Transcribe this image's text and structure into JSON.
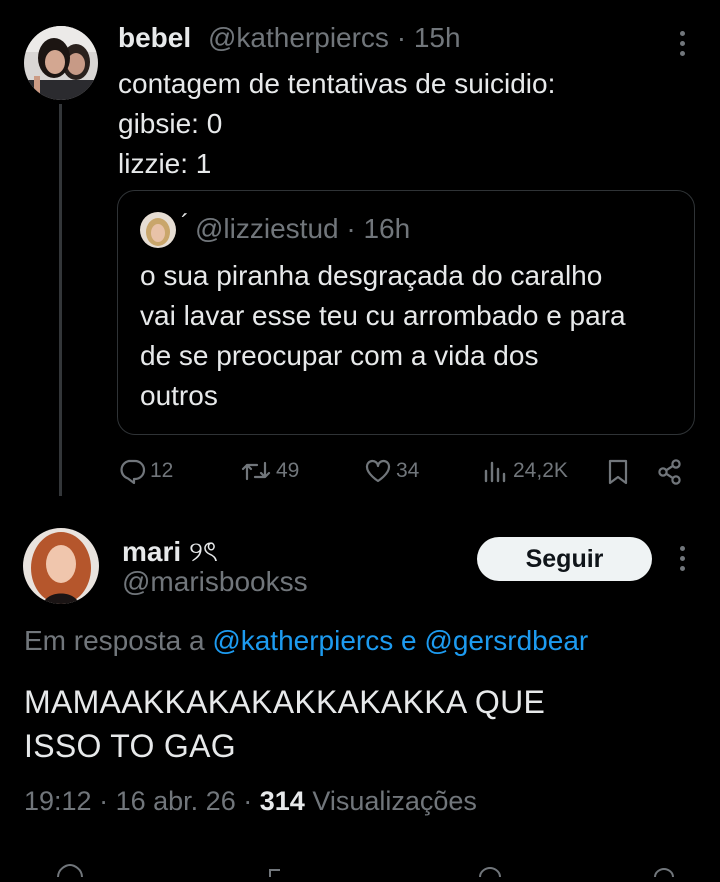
{
  "tweet1": {
    "display_name": "bebel",
    "handle": "@katherpiercs",
    "time": "15h",
    "lines": "contagem de tentativas de suicidio:\ngibsie: 0\nlizzie: 1"
  },
  "quote": {
    "name_glyph": "´",
    "handle": "@lizziestud",
    "time": "16h",
    "text": "o sua piranha desgraçada do caralho\nvai lavar esse teu cu arrombado e para\nde se preocupar com a vida dos\noutros"
  },
  "actions": {
    "replies": "12",
    "retweets": "49",
    "likes": "34",
    "views": "24,2K"
  },
  "tweet2": {
    "display_name": "mari",
    "name_emoji": "୨ৎ",
    "handle": "@marisbookss",
    "follow_label": "Seguir",
    "reply_prefix": "Em resposta a",
    "reply_user1": "@katherpiercs",
    "reply_and": "e",
    "reply_user2": "@gersrdbear",
    "text": "MAMAAKKAKAKAKKAKAKKA QUE\nISSO TO GAG",
    "time": "19:12",
    "date": "16 abr. 26",
    "views_count": "314",
    "views_label": "Visualizações"
  },
  "icons": {
    "reply": "reply-icon",
    "retweet": "retweet-icon",
    "like": "heart-icon",
    "views": "views-icon",
    "bookmark": "bookmark-icon",
    "share": "share-icon",
    "more": "more-icon"
  },
  "colors": {
    "background": "#000000",
    "text": "#e7e9ea",
    "muted": "#71767b",
    "link": "#1d9bf0",
    "follow_bg": "#eff3f4"
  }
}
